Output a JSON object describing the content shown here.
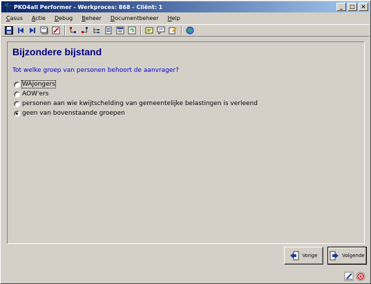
{
  "window": {
    "title": "PKO4all Performer - Werkproces: 868 - Cliënt: 1",
    "minimize": "_",
    "maximize": "□",
    "close": "×"
  },
  "menu": {
    "items": [
      {
        "first": "C",
        "rest": "asus"
      },
      {
        "first": "A",
        "rest": "ctie"
      },
      {
        "first": "D",
        "rest": "ebug"
      },
      {
        "first": "B",
        "rest": "eheer"
      },
      {
        "first": "D",
        "rest": "ocumentbeheer"
      },
      {
        "first": "H",
        "rest": "elp"
      }
    ]
  },
  "toolbar": {
    "icons": [
      "save-icon",
      "first-record-icon",
      "next-record-icon",
      "view-icon",
      "edit-icon",
      "sep",
      "tree-expand-icon",
      "tree-collapse-icon",
      "tree-structure-icon",
      "document-icon",
      "list-icon",
      "refresh-icon",
      "sep",
      "note-icon",
      "message-icon",
      "edit-note-icon",
      "sep",
      "globe-icon"
    ]
  },
  "page": {
    "heading": "Bijzondere bijstand",
    "question": "Tot welke groep van personen behoort de aanvrager?",
    "options": [
      {
        "label": "WAjongers",
        "checked": false,
        "focused": true
      },
      {
        "label": "AOW'ers",
        "checked": false,
        "focused": false
      },
      {
        "label": "personen aan wie kwijtschelding van gemeentelijke belastingen is verleend",
        "checked": false,
        "focused": false
      },
      {
        "label": "geen van bovenstaande groepen",
        "checked": true,
        "focused": false
      }
    ]
  },
  "buttons": {
    "previous": "Vorige",
    "next": "Volgende"
  }
}
